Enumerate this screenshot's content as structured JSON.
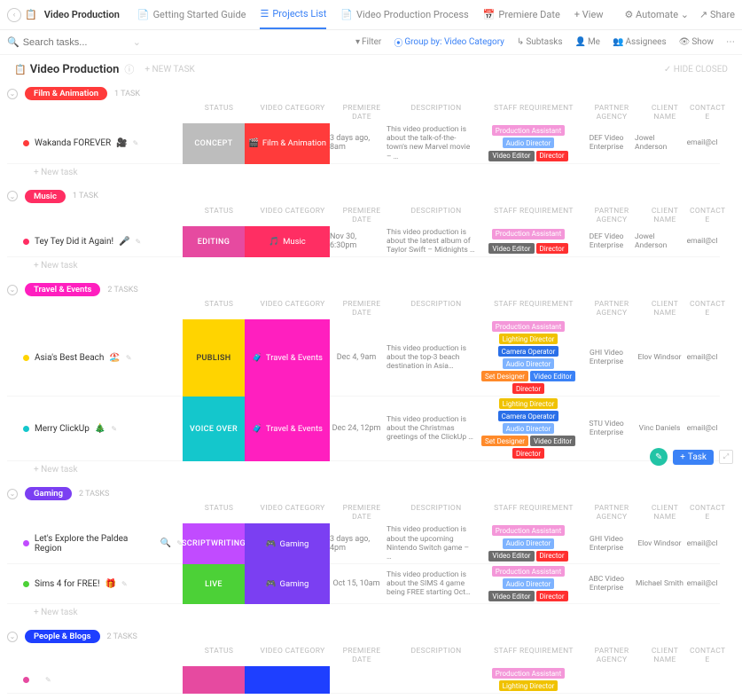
{
  "app_title": "Video Production",
  "tabs": [
    "Getting Started Guide",
    "Projects List",
    "Video Production Process",
    "Premiere Date"
  ],
  "add_view": "+ View",
  "automate": "Automate",
  "share": "Share",
  "search_placeholder": "Search tasks...",
  "filters": {
    "filter": "Filter",
    "group_by": "Group by: Video Category",
    "subtasks": "Subtasks",
    "me": "Me",
    "assignees": "Assignees",
    "show": "Show"
  },
  "title": "Video Production",
  "new_task": "+ NEW TASK",
  "hide_closed": "HIDE CLOSED",
  "new_task_line": "+ New task",
  "cols": {
    "status": "STATUS",
    "cat": "VIDEO CATEGORY",
    "prem": "PREMIERE DATE",
    "desc": "DESCRIPTION",
    "staff": "STAFF REQUIREMENT",
    "agency": "PARTNER AGENCY",
    "client": "CLIENT NAME",
    "contact": "CONTACT E"
  },
  "colors": {
    "film": "#ff3b3b",
    "music": "#ff2e63",
    "travel": "#ff1fbf",
    "gaming": "#7b3ff2",
    "people": "#1e3fff",
    "concept": "#bdbdbd",
    "editing": "#e64aa0",
    "publish": "#ffd400",
    "voiceover": "#14c7cc",
    "scriptwriting": "#c14bff",
    "live": "#4cd137",
    "b_prod": "#f497d9",
    "b_audio": "#7eb3ff",
    "b_vedit": "#6c6c6c",
    "b_director": "#ff3030",
    "b_vedit2": "#3b82f6",
    "b_light": "#f0c200",
    "b_cam": "#2a6fe8",
    "b_set": "#ff8a2a"
  },
  "groups": [
    {
      "name": "Film & Animation",
      "color": "film",
      "count": "1 TASK",
      "rows": [
        {
          "bullet": "#ff3b3b",
          "name": "Wakanda FOREVER",
          "emoji": "🎥",
          "status": "CONCEPT",
          "status_c": "concept",
          "cat": "Film & Animation",
          "cat_c": "film",
          "cat_ico": "🎬",
          "prem": "3 days ago, 8am",
          "desc": "This video production is about the talk-of-the-town's new Marvel movie – …",
          "staff": [
            [
              "Production Assistant",
              "b_prod"
            ],
            [
              "Audio Director",
              "b_audio"
            ],
            [
              "Video Editor",
              "b_vedit"
            ],
            [
              "Director",
              "b_director"
            ]
          ],
          "agency": "DEF Video Enterprise",
          "client": "Jowel Anderson",
          "contact": "email@cl"
        }
      ]
    },
    {
      "name": "Music",
      "color": "music",
      "count": "1 TASK",
      "rows": [
        {
          "bullet": "#ff2e63",
          "name": "Tey Tey Did it Again!",
          "emoji": "🎤",
          "status": "EDITING",
          "status_c": "editing",
          "cat": "Music",
          "cat_c": "music",
          "cat_ico": "🎵",
          "prem": "Nov 30, 6:30pm",
          "desc": "This video production is about the latest album of Taylor Swift – Midnights …",
          "staff": [
            [
              "Production Assistant",
              "b_prod"
            ],
            [
              "Video Editor",
              "b_vedit"
            ],
            [
              "Director",
              "b_director"
            ]
          ],
          "agency": "DEF Video Enterprise",
          "client": "Jowel Anderson",
          "contact": "email@cl"
        }
      ]
    },
    {
      "name": "Travel & Events",
      "color": "travel",
      "count": "2 TASKS",
      "rows": [
        {
          "bullet": "#ffd400",
          "name": "Asia's Best Beach",
          "emoji": "🏖️",
          "status": "PUBLISH",
          "status_c": "publish",
          "cat": "Travel & Events",
          "cat_c": "travel",
          "cat_ico": "🧳",
          "prem": "Dec 4, 9am",
          "desc": "This video production is about the top-3 beach destination in Asia…",
          "staff": [
            [
              "Production Assistant",
              "b_prod"
            ],
            [
              "Lighting Director",
              "b_light"
            ],
            [
              "Camera Operator",
              "b_cam"
            ],
            [
              "Audio Director",
              "b_audio"
            ],
            [
              "Set Designer",
              "b_set"
            ],
            [
              "Video Editor",
              "b_vedit2"
            ],
            [
              "Director",
              "b_director"
            ]
          ],
          "agency": "GHI Video Enterprise",
          "client": "Elov Windsor",
          "contact": "email@cl"
        },
        {
          "bullet": "#14c7cc",
          "name": "Merry ClickUp",
          "emoji": "🎄",
          "status": "VOICE OVER",
          "status_c": "voiceover",
          "cat": "Travel & Events",
          "cat_c": "travel",
          "cat_ico": "🧳",
          "prem": "Dec 24, 12pm",
          "desc": "This video production is about the Christmas greetings of the ClickUp …",
          "staff": [
            [
              "Lighting Director",
              "b_light"
            ],
            [
              "Camera Operator",
              "b_cam"
            ],
            [
              "Audio Director",
              "b_audio"
            ],
            [
              "Set Designer",
              "b_set"
            ],
            [
              "Video Editor",
              "b_vedit"
            ],
            [
              "Director",
              "b_director"
            ]
          ],
          "agency": "STU Video Enterprise",
          "client": "Vinc Daniels",
          "contact": "email@cl"
        }
      ]
    },
    {
      "name": "Gaming",
      "color": "gaming",
      "count": "2 TASKS",
      "rows": [
        {
          "bullet": "#c14bff",
          "name": "Let's Explore the Paldea Region",
          "emoji": "🔍",
          "status": "SCRIPTWRITING",
          "status_c": "scriptwriting",
          "cat": "Gaming",
          "cat_c": "gaming",
          "cat_ico": "🎮",
          "prem": "3 days ago, 4pm",
          "desc": "This video production is about the upcoming Nintendo Switch game – …",
          "staff": [
            [
              "Production Assistant",
              "b_prod"
            ],
            [
              "Audio Director",
              "b_audio"
            ],
            [
              "Video Editor",
              "b_vedit"
            ],
            [
              "Director",
              "b_director"
            ]
          ],
          "agency": "GHI Video Enterprise",
          "client": "Elov Windsor",
          "contact": "email@cl"
        },
        {
          "bullet": "#4cd137",
          "name": "Sims 4 for FREE!",
          "emoji": "🎁",
          "status": "LIVE",
          "status_c": "live",
          "cat": "Gaming",
          "cat_c": "gaming",
          "cat_ico": "🎮",
          "prem": "Oct 15, 10am",
          "desc": "This video production is about the SIMS 4 game being FREE starting Oct…",
          "staff": [
            [
              "Production Assistant",
              "b_prod"
            ],
            [
              "Audio Director",
              "b_audio"
            ],
            [
              "Video Editor",
              "b_vedit"
            ],
            [
              "Director",
              "b_director"
            ]
          ],
          "agency": "ABC Video Enterprise",
          "client": "Michael Smith",
          "contact": "email@cl"
        }
      ]
    },
    {
      "name": "People & Blogs",
      "color": "people",
      "count": "2 TASKS",
      "rows": [
        {
          "bullet": "#e64aa0",
          "name": "",
          "emoji": "",
          "status": "",
          "status_c": "editing",
          "cat": "",
          "cat_c": "people",
          "cat_ico": "",
          "prem": "",
          "desc": "",
          "staff": [
            [
              "Production Assistant",
              "b_prod"
            ],
            [
              "Lighting Director",
              "b_light"
            ]
          ],
          "agency": "",
          "client": "",
          "contact": ""
        }
      ]
    }
  ],
  "fab": {
    "task": "Task"
  }
}
